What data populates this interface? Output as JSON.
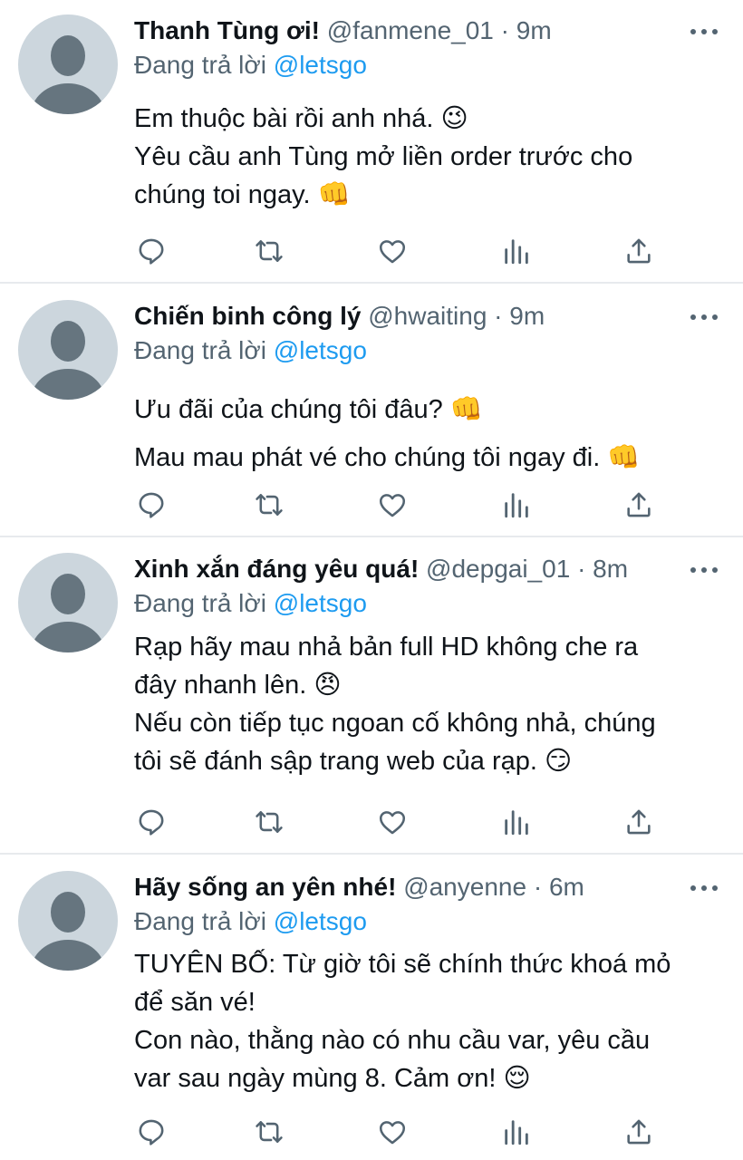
{
  "reply_prefix": "Đang trả lời",
  "tweets": [
    {
      "name": "Thanh Tùng ơi!",
      "handle": "@fanmene_01",
      "separator": "·",
      "time": "9m",
      "reply_to": "@letsgo",
      "lines": [
        "Em thuộc bài rồi anh nhá. 😉",
        "Yêu cầu anh Tùng mở liền order trước cho",
        "chúng toi ngay. 👊"
      ]
    },
    {
      "name": "Chiến binh công lý",
      "handle": "@hwaiting",
      "separator": "·",
      "time": "9m",
      "reply_to": "@letsgo",
      "lines": [
        "Ưu đãi của chúng tôi đâu? 👊",
        "Mau mau phát vé cho chúng tôi ngay đi. 👊"
      ]
    },
    {
      "name": "Xinh xắn đáng yêu quá!",
      "handle": "@depgai_01",
      "separator": "·",
      "time": "8m",
      "reply_to": "@letsgo",
      "lines": [
        "Rạp hãy mau nhả bản full HD không che ra",
        "đây nhanh lên. 😠",
        "Nếu còn tiếp tục ngoan cố không nhả, chúng",
        "tôi sẽ đánh sập trang web của rạp. 😏"
      ]
    },
    {
      "name": "Hãy sống an yên nhé!",
      "handle": "@anyenne",
      "separator": "·",
      "time": "6m",
      "reply_to": "@letsgo",
      "lines": [
        "TUYÊN BỐ: Từ giờ tôi sẽ chính thức khoá mỏ",
        "để săn vé!",
        "Con nào, thằng nào có nhu cầu var, yêu cầu",
        "var sau ngày mùng 8. Cảm ơn! 😌"
      ]
    }
  ],
  "icons": {
    "reply": "reply-icon",
    "retweet": "retweet-icon",
    "like": "like-icon",
    "analytics": "analytics-icon",
    "share": "share-icon",
    "more": "more-icon",
    "avatar": "default-avatar"
  },
  "colors": {
    "text": "#0f1419",
    "secondary": "#536471",
    "mention": "#1d9bf0",
    "avatar_bg": "#ccd6dd",
    "avatar_fg": "#66757f",
    "divider": "#e7eaed"
  }
}
